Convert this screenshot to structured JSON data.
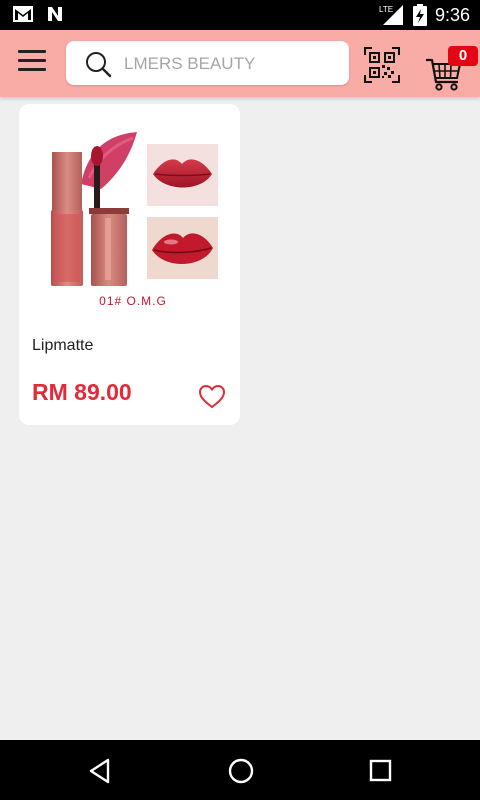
{
  "status_bar": {
    "time": "9:36",
    "network": "LTE",
    "icons": [
      "gmail-icon",
      "n-notification-icon",
      "signal-icon",
      "battery-charging-icon"
    ]
  },
  "header": {
    "search_placeholder": "LMERS BEAUTY",
    "cart_count": "0",
    "icons": [
      "menu-icon",
      "search-icon",
      "qr-scan-icon",
      "cart-icon"
    ],
    "colors": {
      "header_bg": "#f9aba6",
      "badge": "#e30613"
    }
  },
  "products": [
    {
      "name": "Lipmatte",
      "price": "RM 89.00",
      "shade_label": "01# O.M.G",
      "colors": {
        "price": "#e32a38",
        "shade_label": "#c0182a"
      }
    }
  ],
  "nav": {
    "icons": [
      "back-icon",
      "home-icon",
      "recent-apps-icon"
    ]
  }
}
